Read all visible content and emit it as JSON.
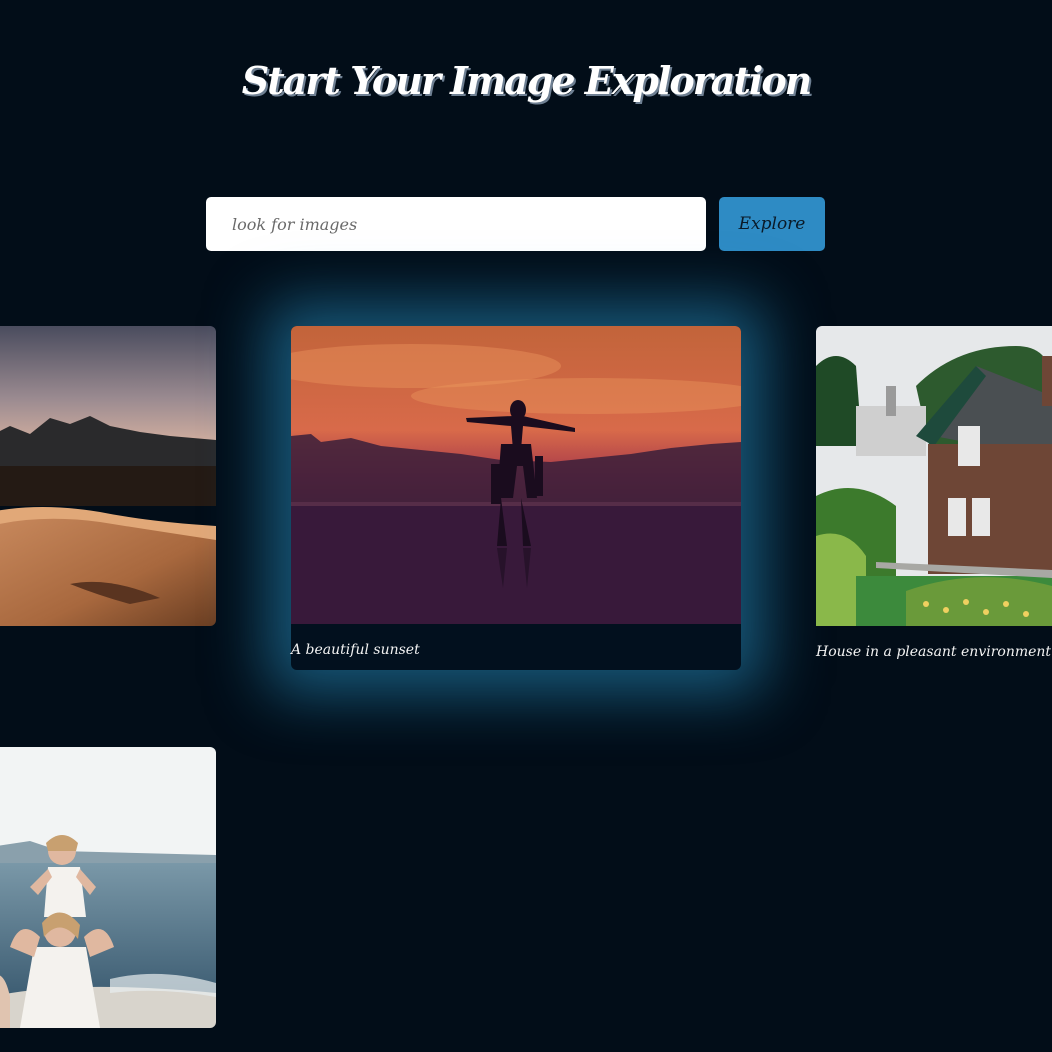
{
  "header": {
    "title": "Start Your Image Exploration"
  },
  "search": {
    "placeholder": "look for images",
    "value": "",
    "button_label": "Explore"
  },
  "gallery": {
    "cards": [
      {
        "caption": "",
        "image": "desert dunes with mountains at dusk"
      },
      {
        "caption": "A beautiful sunset",
        "image": "silhouette of person on shoulders at sunset"
      },
      {
        "caption": "House in a pleasant environment",
        "image": "brick house with garden"
      },
      {
        "caption": "",
        "image": "mother carrying child on shoulders at the beach"
      }
    ]
  },
  "colors": {
    "background": "#020d18",
    "accent": "#2e8bc4",
    "glow": "#2896c8"
  }
}
